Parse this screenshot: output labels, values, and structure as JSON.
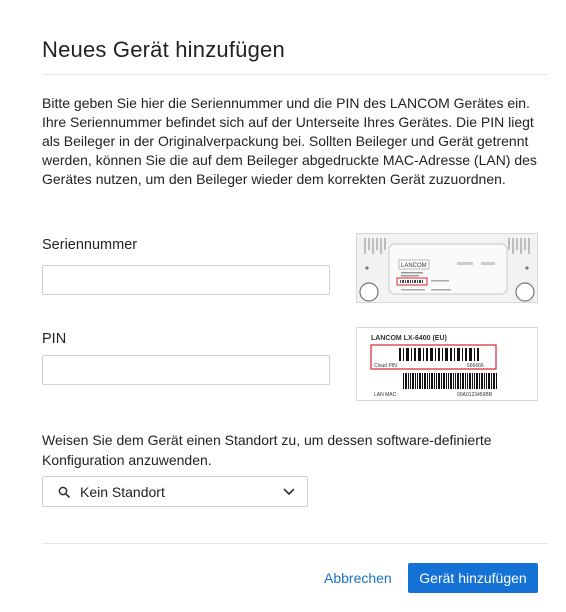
{
  "dialog": {
    "title": "Neues Gerät hinzufügen",
    "description": "Bitte geben Sie hier die Seriennummer und die PIN des LANCOM Gerätes ein. Ihre Seriennummer befindet sich auf der Unterseite Ihres Gerätes. Die PIN liegt als Beileger in der Originalverpackung bei. Sollten Beileger und Gerät getrennt werden, können Sie die auf dem Beileger abgedruckte MAC-Adresse (LAN) des Gerätes nutzen, um den Beileger wieder dem korrekten Gerät zuzuordnen."
  },
  "serial": {
    "label": "Seriennummer",
    "value": "",
    "placeholder": ""
  },
  "pin": {
    "label": "PIN",
    "value": "",
    "placeholder": ""
  },
  "device_image": {
    "brand": "LANCOM"
  },
  "sticker_image": {
    "model": "LANCOM LX-6400 (EU)",
    "pin_label": "Cloud PIN:",
    "pin_value": "666666",
    "mac_label": "LAN MAC:",
    "mac_value": "00A0123456BB"
  },
  "location": {
    "description": "Weisen Sie dem Gerät einen Standort zu, um dessen software-definierte Konfiguration anzuwenden.",
    "selected": "Kein Standort",
    "search_icon": "search-icon",
    "chevron_icon": "chevron-down-icon"
  },
  "actions": {
    "cancel_label": "Abbrechen",
    "submit_label": "Gerät hinzufügen"
  },
  "colors": {
    "accent": "#1472d6",
    "link": "#1a73c8",
    "highlight": "#d9232d"
  }
}
